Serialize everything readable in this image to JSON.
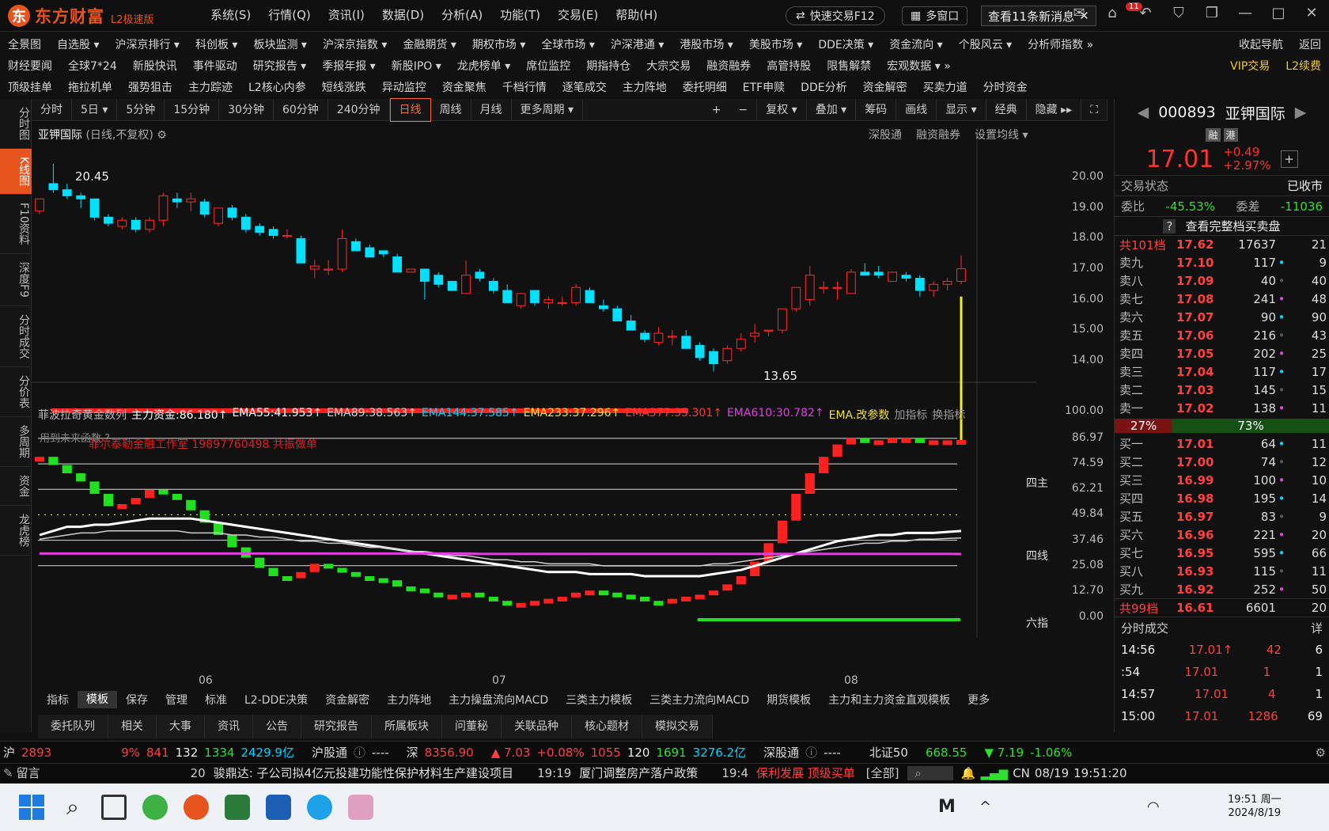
{
  "app": {
    "name": "东方财富",
    "edition": "L2极速版"
  },
  "menu": [
    "系统(S)",
    "行情(Q)",
    "资讯(I)",
    "数据(D)",
    "分析(A)",
    "功能(T)",
    "交易(E)",
    "帮助(H)"
  ],
  "quick_trade": "快速交易F12",
  "multi_window": "多窗口",
  "news_button": "查看11条新消息",
  "news_badge": "11",
  "nav1": [
    "全景图",
    "自选股 ▾",
    "沪深京排行 ▾",
    "科创板 ▾",
    "板块监测 ▾",
    "沪深京指数 ▾",
    "金融期货 ▾",
    "期权市场 ▾",
    "全球市场 ▾",
    "沪深港通 ▾",
    "港股市场 ▾",
    "美股市场 ▾",
    "DDE决策 ▾",
    "资金流向 ▾",
    "个股风云 ▾",
    "分析师指数 »",
    "收起导航",
    "返回"
  ],
  "nav2": [
    "财经要闻",
    "全球7*24",
    "新股快讯",
    "事件驱动",
    "研究报告 ▾",
    "季报年报 ▾",
    "新股IPO ▾",
    "龙虎榜单 ▾",
    "席位监控",
    "期指持仓",
    "大宗交易",
    "融资融券",
    "高管持股",
    "限售解禁",
    "宏观数据 ▾ »",
    "VIP交易",
    "L2续费"
  ],
  "nav3": [
    "顶级挂单",
    "拖拉机单",
    "强势狙击",
    "主力踪迹",
    "L2核心内参",
    "短线涨跌",
    "异动监控",
    "资金聚焦",
    "千档行情",
    "逐笔成交",
    "主力阵地",
    "委托明细",
    "ETF申赎",
    "DDE分析",
    "资金解密",
    "买卖力道",
    "分时资金"
  ],
  "left_sidebar": [
    "分时图",
    "K线图",
    "F10资料",
    "深度F9",
    "分时成交",
    "分价表",
    "多周期",
    "资金",
    "龙虎榜"
  ],
  "periods": [
    "分时",
    "5日 ▾",
    "5分钟",
    "15分钟",
    "30分钟",
    "60分钟",
    "240分钟",
    "日线",
    "周线",
    "月线",
    "更多周期 ▾"
  ],
  "chart_tools": [
    "+",
    "−",
    "复权 ▾",
    "叠加 ▾",
    "筹码",
    "画线",
    "显示 ▾",
    "经典",
    "隐藏 ▸▸"
  ],
  "chart_head": {
    "stock": "亚钾国际",
    "mode": "(日线,不复权)",
    "right": [
      "深股通",
      "融资融券",
      "设置均线 ▾"
    ]
  },
  "indicator_bar": {
    "name": "菲波拉奇黄金数列",
    "main": "主力资金:86.180↑",
    "ema55": "EMA55:41.953↑",
    "ema89": "EMA89:38.563↑",
    "ema144": "EMA144:37.585↑",
    "ema233": "EMA233:37.296↑",
    "ema377": "EMA377:35.301↑",
    "ema610": "EMA610:30.782↑",
    "ema_edit": "EMA.改参数",
    "add": "加指标",
    "switch": "换指标"
  },
  "indicator_note": "用到未来函数 ?",
  "watermark": "菲尔泰勒金融工作室 19897760498 共振做单",
  "ind_labels": {
    "si": "四主",
    "ling": "四线",
    "liu": "六指"
  },
  "colors": {
    "up": "#ff2a2a",
    "down": "#00e0ff",
    "ema55": "#ffffff",
    "ema89": "#cfcfcf",
    "ema144": "#00d4ff",
    "ema233": "#f0e040",
    "ema377": "#ff3a3a",
    "ema610": "#e040e0",
    "yellowbar": "#f0f020"
  },
  "chart_data": [
    {
      "type": "candlestick",
      "title": "亚钾国际 (日线,不复权)",
      "ylim": [
        13.5,
        20.5
      ],
      "yticks": [
        20.0,
        19.0,
        18.0,
        17.0,
        16.0,
        15.0,
        14.0
      ],
      "xticks": [
        "06",
        "07",
        "08"
      ],
      "annotations": [
        "20.45",
        "13.65"
      ],
      "candles": [
        [
          18.9,
          19.3,
          18.8,
          19.3
        ],
        [
          19.8,
          20.45,
          19.5,
          19.6
        ],
        [
          19.6,
          19.8,
          19.3,
          19.4
        ],
        [
          19.4,
          19.5,
          19.0,
          19.3
        ],
        [
          19.3,
          19.3,
          18.6,
          18.7
        ],
        [
          18.7,
          18.8,
          18.4,
          18.5
        ],
        [
          18.4,
          18.7,
          18.3,
          18.6
        ],
        [
          18.6,
          18.7,
          18.2,
          18.3
        ],
        [
          18.3,
          18.7,
          18.2,
          18.6
        ],
        [
          18.6,
          19.5,
          18.4,
          19.4
        ],
        [
          19.3,
          19.5,
          19.0,
          19.2
        ],
        [
          19.2,
          19.5,
          18.9,
          19.3
        ],
        [
          19.2,
          19.3,
          18.7,
          18.8
        ],
        [
          18.5,
          19.0,
          18.4,
          19.0
        ],
        [
          19.0,
          19.1,
          18.6,
          18.7
        ],
        [
          18.7,
          18.8,
          18.2,
          18.3
        ],
        [
          18.4,
          18.5,
          18.1,
          18.2
        ],
        [
          18.3,
          18.4,
          18.0,
          18.1
        ],
        [
          18.1,
          18.3,
          18.0,
          18.1
        ],
        [
          18.0,
          18.1,
          17.2,
          17.2
        ],
        [
          17.0,
          17.3,
          16.7,
          17.1
        ],
        [
          17.0,
          17.3,
          16.8,
          17.0
        ],
        [
          17.0,
          18.3,
          16.9,
          18.0
        ],
        [
          17.9,
          18.0,
          17.6,
          17.6
        ],
        [
          17.7,
          17.8,
          17.4,
          17.4
        ],
        [
          17.6,
          17.6,
          17.4,
          17.5
        ],
        [
          17.4,
          17.5,
          16.9,
          16.9
        ],
        [
          16.9,
          17.0,
          16.9,
          17.0
        ],
        [
          17.0,
          17.0,
          16.0,
          16.6
        ],
        [
          16.8,
          16.9,
          16.4,
          16.5
        ],
        [
          16.6,
          16.6,
          16.3,
          16.3
        ],
        [
          16.2,
          17.3,
          16.2,
          16.8
        ],
        [
          16.9,
          17.0,
          16.6,
          16.7
        ],
        [
          16.6,
          16.7,
          16.2,
          16.3
        ],
        [
          16.3,
          16.5,
          15.9,
          15.9
        ],
        [
          15.8,
          16.2,
          15.7,
          16.2
        ],
        [
          16.3,
          16.3,
          15.8,
          15.9
        ],
        [
          15.9,
          16.1,
          15.7,
          16.0
        ],
        [
          15.9,
          16.1,
          15.8,
          15.9
        ],
        [
          15.9,
          16.5,
          15.8,
          16.4
        ],
        [
          16.3,
          16.4,
          15.9,
          15.9
        ],
        [
          15.8,
          16.0,
          15.6,
          15.7
        ],
        [
          15.7,
          15.8,
          15.3,
          15.3
        ],
        [
          15.3,
          15.5,
          15.2,
          15.0
        ],
        [
          14.9,
          15.0,
          14.6,
          14.7
        ],
        [
          14.6,
          15.1,
          14.5,
          14.9
        ],
        [
          14.8,
          15.0,
          14.5,
          14.8
        ],
        [
          14.8,
          15.0,
          14.4,
          14.4
        ],
        [
          14.5,
          14.6,
          14.0,
          14.1
        ],
        [
          14.3,
          14.4,
          13.65,
          13.9
        ],
        [
          14.0,
          14.5,
          13.9,
          14.4
        ],
        [
          14.4,
          14.9,
          14.3,
          14.7
        ],
        [
          14.8,
          15.2,
          14.6,
          14.9
        ],
        [
          15.0,
          15.0,
          14.8,
          15.0
        ],
        [
          15.0,
          15.7,
          14.9,
          15.7
        ],
        [
          15.7,
          16.3,
          15.6,
          16.4
        ],
        [
          16.0,
          17.1,
          15.8,
          16.8
        ],
        [
          16.4,
          16.6,
          16.2,
          16.4
        ],
        [
          16.4,
          16.6,
          16.0,
          16.4
        ],
        [
          16.2,
          17.0,
          16.2,
          16.9
        ],
        [
          16.9,
          17.2,
          16.8,
          16.8
        ],
        [
          16.9,
          17.1,
          16.7,
          16.8
        ],
        [
          16.6,
          16.9,
          16.7,
          16.9
        ],
        [
          16.8,
          16.9,
          16.6,
          16.7
        ],
        [
          16.7,
          16.8,
          16.1,
          16.3
        ],
        [
          16.3,
          16.6,
          16.1,
          16.5
        ],
        [
          16.5,
          16.7,
          16.3,
          16.6
        ],
        [
          16.6,
          17.45,
          16.5,
          17.01
        ]
      ]
    },
    {
      "type": "line",
      "title": "菲波拉奇黄金数列",
      "ylim": [
        0,
        100
      ],
      "yticks": [
        100.0,
        86.97,
        74.59,
        62.21,
        49.84,
        37.46,
        25.08,
        12.7,
        0.0
      ],
      "series": [
        {
          "name": "主力资金",
          "values": [
            78,
            74,
            70,
            66,
            60,
            54,
            55,
            58,
            62,
            60,
            57,
            52,
            46,
            40,
            34,
            29,
            24,
            20,
            19,
            22,
            26,
            24,
            22,
            20,
            19,
            18,
            15,
            14,
            12,
            10,
            11,
            12,
            10,
            8,
            6,
            7,
            8,
            9,
            10,
            12,
            13,
            12,
            11,
            10,
            8,
            7,
            9,
            10,
            11,
            13,
            16,
            20,
            27,
            36,
            47,
            60,
            70,
            78,
            84,
            87,
            86,
            86,
            87,
            87,
            86,
            86,
            86,
            86.18
          ]
        },
        {
          "name": "EMA55",
          "values": [
            40,
            42,
            44,
            44,
            45,
            45,
            46,
            47,
            48,
            48,
            48,
            48,
            47,
            46,
            45,
            44,
            43,
            42,
            41,
            40,
            39,
            38,
            37,
            36,
            35,
            34,
            33,
            32,
            31,
            30,
            29,
            28,
            27,
            26,
            25,
            24,
            23,
            22,
            22,
            22,
            21,
            21,
            21,
            21,
            20,
            20,
            20,
            20,
            20,
            21,
            22,
            23,
            25,
            27,
            29,
            31,
            33,
            35,
            37,
            38,
            39,
            40,
            40,
            41,
            41,
            41,
            41.5,
            41.95
          ]
        },
        {
          "name": "EMA89",
          "values": [
            38,
            39,
            40,
            41,
            41,
            42,
            42,
            42,
            42,
            42,
            42,
            41,
            41,
            41,
            40,
            40,
            39,
            39,
            38,
            37,
            37,
            36,
            36,
            35,
            34,
            34,
            33,
            32,
            32,
            31,
            30,
            30,
            29,
            28,
            28,
            27,
            27,
            26,
            26,
            26,
            26,
            25,
            25,
            25,
            25,
            25,
            25,
            25,
            25,
            26,
            26,
            27,
            28,
            29,
            30,
            31,
            32,
            33,
            34,
            35,
            36,
            36,
            37,
            37,
            38,
            38,
            38.3,
            38.56
          ]
        },
        {
          "name": "EMA610",
          "values": [
            31,
            31,
            31,
            31,
            31,
            31,
            31,
            31,
            31,
            31,
            31,
            31,
            31,
            31,
            31,
            31,
            31,
            31,
            31,
            31,
            31,
            31,
            31,
            31,
            31,
            31,
            31,
            31,
            31,
            31,
            31,
            31,
            30.8,
            30.8,
            30.8,
            30.8,
            30.8,
            30.8,
            30.8,
            30.8,
            30.8,
            30.8,
            30.8,
            30.8,
            30.8,
            30.8,
            30.8,
            30.8,
            30.8,
            30.8,
            30.8,
            30.8,
            30.8,
            30.8,
            30.8,
            30.8,
            30.8,
            30.8,
            30.8,
            30.8,
            30.8,
            30.8,
            30.8,
            30.8,
            30.8,
            30.8,
            30.8,
            30.78
          ]
        }
      ]
    }
  ],
  "right": {
    "code": "000893",
    "name": "亚钾国际",
    "tags": [
      "融",
      "港"
    ],
    "price": "17.01",
    "change": "+0.49",
    "pct": "+2.97%",
    "status_label": "交易状态",
    "status": "已收市",
    "wb_label": "委比",
    "wb": "-45.53%",
    "wc_label": "委差",
    "wc": "-11036",
    "full_depth": "查看完整档买卖盘",
    "sell_total": {
      "l": "共101档",
      "p": "17.62",
      "v": "17637",
      "r": "21"
    },
    "asks": [
      {
        "l": "卖九",
        "p": "17.10",
        "v": "117",
        "d": "•",
        "r": "9"
      },
      {
        "l": "卖八",
        "p": "17.09",
        "v": "40",
        "d": "•",
        "r": "40"
      },
      {
        "l": "卖七",
        "p": "17.08",
        "v": "241",
        "d": "•",
        "r": "48"
      },
      {
        "l": "卖六",
        "p": "17.07",
        "v": "90",
        "d": "•",
        "r": "90"
      },
      {
        "l": "卖五",
        "p": "17.06",
        "v": "216",
        "d": "•",
        "r": "43"
      },
      {
        "l": "卖四",
        "p": "17.05",
        "v": "202",
        "d": "•",
        "r": "25"
      },
      {
        "l": "卖三",
        "p": "17.04",
        "v": "117",
        "d": "•",
        "r": "17"
      },
      {
        "l": "卖二",
        "p": "17.03",
        "v": "145",
        "d": "•",
        "r": "15"
      },
      {
        "l": "卖一",
        "p": "17.02",
        "v": "138",
        "d": "•",
        "r": "11"
      }
    ],
    "ratio_left": "27%",
    "ratio_right": "73%",
    "bids": [
      {
        "l": "买一",
        "p": "17.01",
        "v": "64",
        "d": "•",
        "r": "11"
      },
      {
        "l": "买二",
        "p": "17.00",
        "v": "74",
        "d": "•",
        "r": "12"
      },
      {
        "l": "买三",
        "p": "16.99",
        "v": "100",
        "d": "•",
        "r": "10"
      },
      {
        "l": "买四",
        "p": "16.98",
        "v": "195",
        "d": "•",
        "r": "14"
      },
      {
        "l": "买五",
        "p": "16.97",
        "v": "83",
        "d": "•",
        "r": "9"
      },
      {
        "l": "买六",
        "p": "16.96",
        "v": "221",
        "d": "•",
        "r": "20"
      },
      {
        "l": "买七",
        "p": "16.95",
        "v": "595",
        "d": "•",
        "r": "66"
      },
      {
        "l": "买八",
        "p": "16.93",
        "v": "115",
        "d": "•",
        "r": "11"
      },
      {
        "l": "买九",
        "p": "16.92",
        "v": "252",
        "d": "•",
        "r": "50"
      }
    ],
    "buy_total": {
      "l": "共99档",
      "p": "16.61",
      "v": "6601",
      "r": "20"
    },
    "ticks_title": "分时成交",
    "ticks_detail": "详",
    "ticks": [
      {
        "t": "14:56",
        "p": "17.01↑",
        "v": "42",
        "r": "6"
      },
      {
        "t": ":54",
        "p": "17.01",
        "v": "1",
        "r": "1"
      },
      {
        "t": "14:57",
        "p": "17.01",
        "v": "4",
        "r": "1"
      },
      {
        "t": "15:00",
        "p": "17.01",
        "v": "1286",
        "r": "69"
      }
    ]
  },
  "bottom_tabs": [
    "指标",
    "模板",
    "保存",
    "管理",
    "标准",
    "L2-DDE决策",
    "资金解密",
    "主力阵地",
    "主力操盘流向MACD",
    "三类主力模板",
    "三类主力流向MACD",
    "期货模板",
    "主力和主力资金直观模板",
    "更多"
  ],
  "main_tabs": [
    "委托队列",
    "相关",
    "大事",
    "资讯",
    "公告",
    "研究报告",
    "所属板块",
    "问董秘",
    "关联品种",
    "核心题材",
    "模拟交易"
  ],
  "status": {
    "sh": "沪",
    "sh_val": "2893",
    "sh_pct": "9%",
    "a": "841",
    "b": "132",
    "c": "1334",
    "amt": "2429.9亿",
    "hgt": "沪股通",
    "hgt_v": "----",
    "sz": "深",
    "sz_val": "8356.90",
    "sz_chg": "▲ 7.03",
    "sz_pct": "+0.08%",
    "d": "1055",
    "e": "120",
    "f": "1691",
    "sz_amt": "3276.2亿",
    "sgt": "深股通",
    "sgt_v": "----",
    "bz": "北证50",
    "bz_val": "668.55",
    "bz_chg": "▼ 7.19",
    "bz_pct": "-1.06%"
  },
  "news": {
    "left": "留言",
    "t1": "20",
    "n1": "骏鼎达: 子公司拟4亿元投建功能性保护材料生产建设项目",
    "t2": "19:19",
    "n2": "厦门调整房产落户政策",
    "t3": "19:4",
    "n3": "保利发展 顶级买单",
    "all": "[全部]",
    "lang": "CN",
    "date": "08/19",
    "time": "19:51:20"
  },
  "taskbar": {
    "time": "19:51 周一",
    "date": "2024/8/19"
  }
}
